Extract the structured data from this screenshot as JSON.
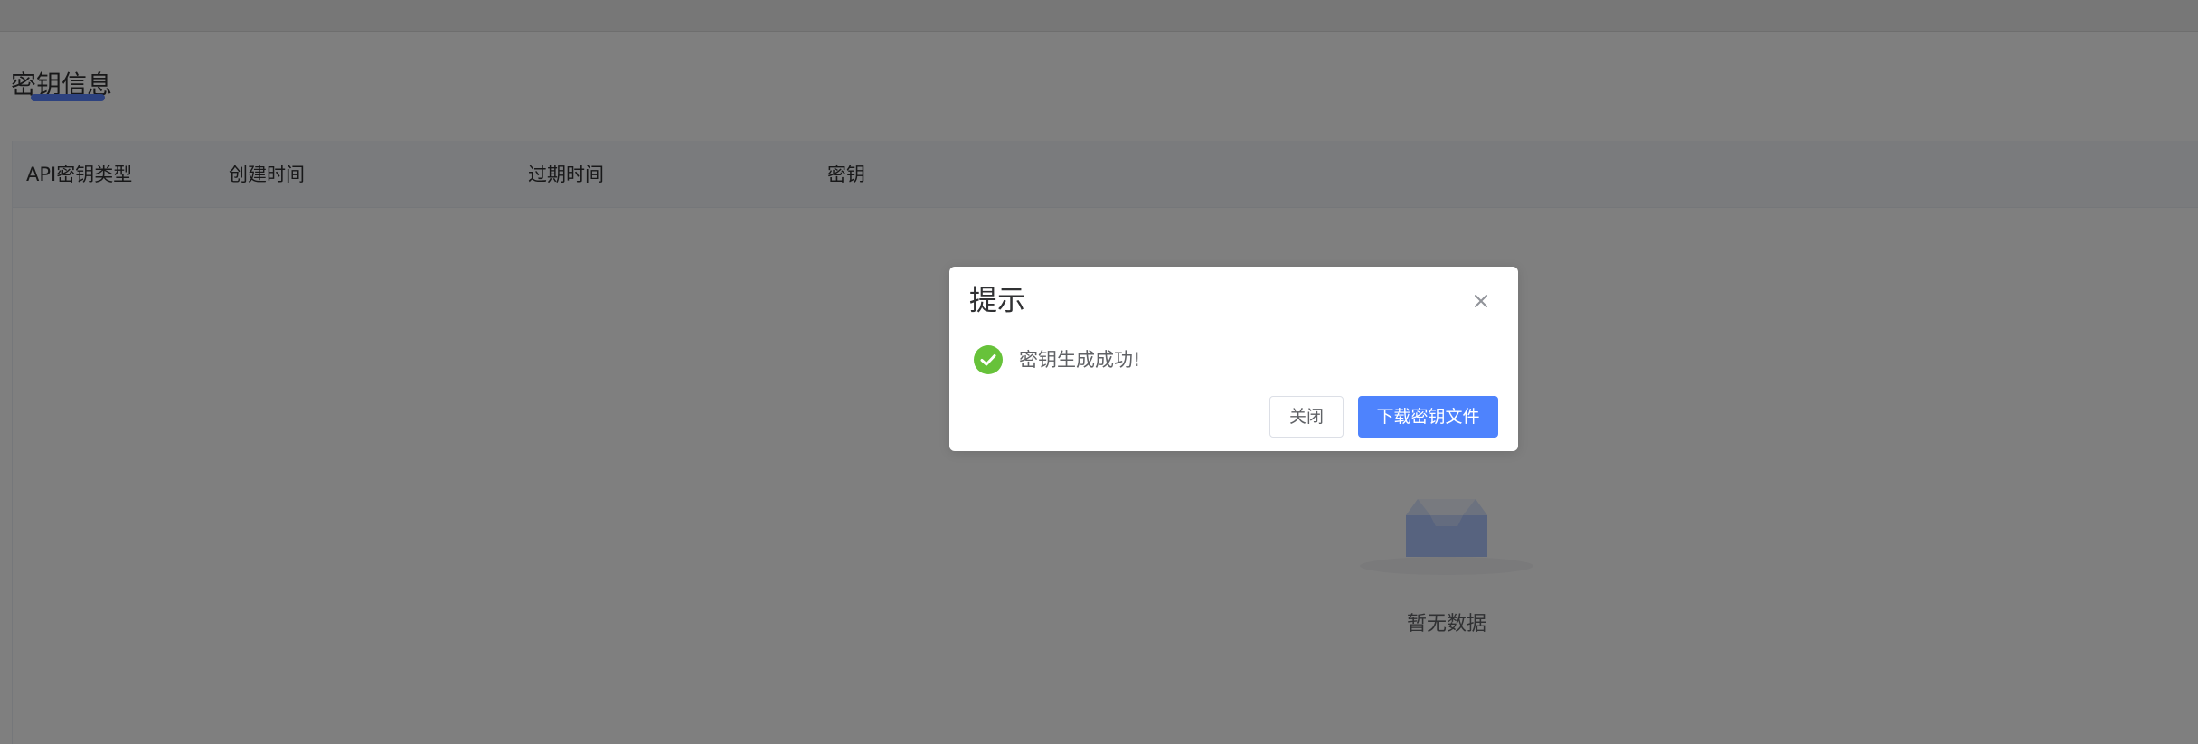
{
  "page": {
    "section_title": "密钥信息"
  },
  "table": {
    "columns": [
      "API密钥类型",
      "创建时间",
      "过期时间",
      "密钥"
    ],
    "empty_text": "暂无数据"
  },
  "dialog": {
    "title": "提示",
    "message": "密钥生成成功!",
    "buttons": {
      "close_label": "关闭",
      "download_label": "下载密钥文件"
    },
    "icons": {
      "close": "close-icon",
      "status": "success-check-icon"
    }
  },
  "colors": {
    "primary": "#4e83fd",
    "success": "#67c23a"
  }
}
